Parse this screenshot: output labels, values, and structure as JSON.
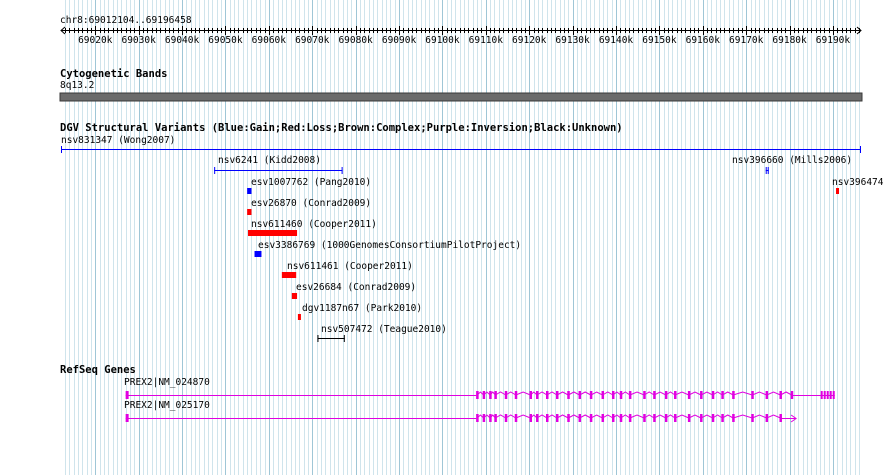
{
  "ruler": {
    "range_label": "chr8:69012104..69196458",
    "start": 69012104,
    "end": 69196458,
    "ticks": [
      69020000,
      69030000,
      69040000,
      69050000,
      69060000,
      69070000,
      69080000,
      69090000,
      69100000,
      69110000,
      69120000,
      69130000,
      69140000,
      69150000,
      69160000,
      69170000,
      69180000,
      69190000
    ],
    "tick_labels": [
      "69020k",
      "69030k",
      "69040k",
      "69050k",
      "69060k",
      "69070k",
      "69080k",
      "69090k",
      "69100k",
      "69110k",
      "69120k",
      "69130k",
      "69140k",
      "69150k",
      "69160k",
      "69170k",
      "69180k",
      "69190k"
    ]
  },
  "cytoband": {
    "title": "Cytogenetic Bands",
    "band": "8q13.2"
  },
  "dgv": {
    "title": "DGV Structural Variants (Blue:Gain;Red:Loss;Brown:Complex;Purple:Inversion;Black:Unknown)",
    "colors": {
      "gain": "#0000ff",
      "loss": "#ff0000",
      "unknown": "#000000"
    },
    "features": [
      {
        "label": "nsv831347 (Wong2007)",
        "type": "gain",
        "start": 69012104,
        "end": 69196458,
        "style": "line"
      },
      {
        "label": "nsv6241 (Kidd2008)",
        "type": "gain",
        "start": 69047400,
        "end": 69077000,
        "style": "line"
      },
      {
        "label": "nsv396660 (Mills2006)",
        "type": "gain",
        "start": 69174500,
        "end": 69174900,
        "style": "line"
      },
      {
        "label": "nsv396474",
        "type": "loss",
        "start": 69190700,
        "end": 69191100,
        "style": "bar"
      },
      {
        "label": "esv1007762 (Pang2010)",
        "type": "gain",
        "start": 69055000,
        "end": 69056000,
        "style": "bar"
      },
      {
        "label": "esv26870 (Conrad2009)",
        "type": "loss",
        "start": 69055000,
        "end": 69056000,
        "style": "bar"
      },
      {
        "label": "nsv611460 (Cooper2011)",
        "type": "loss",
        "start": 69055200,
        "end": 69066500,
        "style": "bar"
      },
      {
        "label": "esv3386769 (1000GenomesConsortiumPilotProject)",
        "type": "gain",
        "start": 69056700,
        "end": 69058300,
        "style": "bar"
      },
      {
        "label": "nsv611461 (Cooper2011)",
        "type": "loss",
        "start": 69063000,
        "end": 69066300,
        "style": "bar"
      },
      {
        "label": "esv26684 (Conrad2009)",
        "type": "loss",
        "start": 69065300,
        "end": 69066500,
        "style": "bar"
      },
      {
        "label": "dgv1187n67 (Park2010)",
        "type": "loss",
        "start": 69066700,
        "end": 69067300,
        "style": "bar"
      },
      {
        "label": "nsv507472 (Teague2010)",
        "type": "unknown",
        "start": 69071200,
        "end": 69077500,
        "style": "line"
      }
    ]
  },
  "refseq": {
    "title": "RefSeq Genes",
    "color": "#e100e1",
    "genes": [
      {
        "label": "PREX2|NM_024870",
        "start": 69027000,
        "end": 69190400
      },
      {
        "label": "PREX2|NM_025170",
        "start": 69027000,
        "end": 69181500
      }
    ]
  }
}
